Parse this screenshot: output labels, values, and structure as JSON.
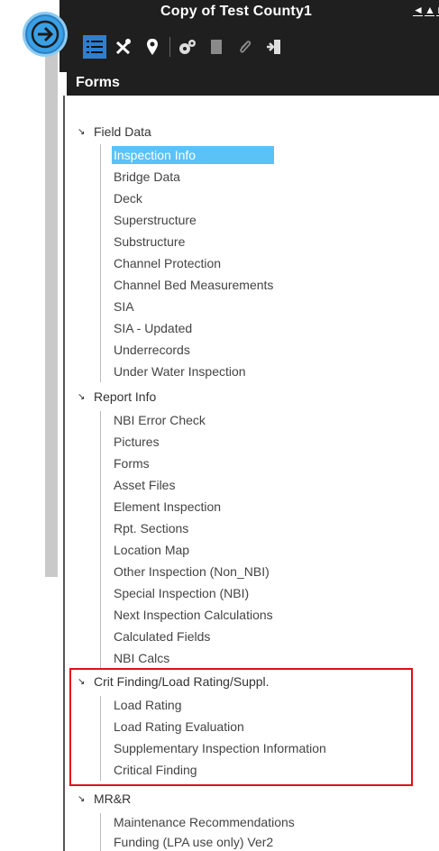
{
  "header": {
    "title": "Copy of Test County1",
    "nav": [
      "◄",
      "▲",
      "►"
    ]
  },
  "toolbar": [
    "list-icon",
    "tools-icon",
    "map-pin-icon",
    "gears-icon",
    "document-icon",
    "paperclip-icon",
    "exit-icon"
  ],
  "panel": {
    "title": "Forms"
  },
  "groups": [
    {
      "label": "Field Data",
      "items": [
        "Inspection Info",
        "Bridge Data",
        "Deck",
        "Superstructure",
        "Substructure",
        "Channel Protection",
        "Channel Bed Measurements",
        "SIA",
        "SIA - Updated",
        "Underrecords",
        "Under Water Inspection"
      ]
    },
    {
      "label": "Report Info",
      "items": [
        "NBI Error Check",
        "Pictures",
        "Forms",
        "Asset Files",
        "Element Inspection",
        "Rpt. Sections",
        "Location Map",
        "Other Inspection (Non_NBI)",
        "Special Inspection (NBI)",
        "Next Inspection Calculations",
        "Calculated Fields",
        "NBI Calcs"
      ]
    },
    {
      "label": "Crit Finding/Load Rating/Suppl.",
      "items": [
        "Load Rating",
        "Load Rating Evaluation",
        "Supplementary Inspection Information",
        "Critical Finding"
      ]
    },
    {
      "label": "MR&R",
      "items": [
        "Maintenance Recommendations",
        "Funding (LPA use only) Ver2"
      ]
    }
  ],
  "selected_item": "Inspection Info",
  "colors": {
    "header": "#1f1f1f",
    "selection": "#5bc2f7",
    "highlight_border": "#e0101a",
    "accent": "#3aa0e6"
  }
}
